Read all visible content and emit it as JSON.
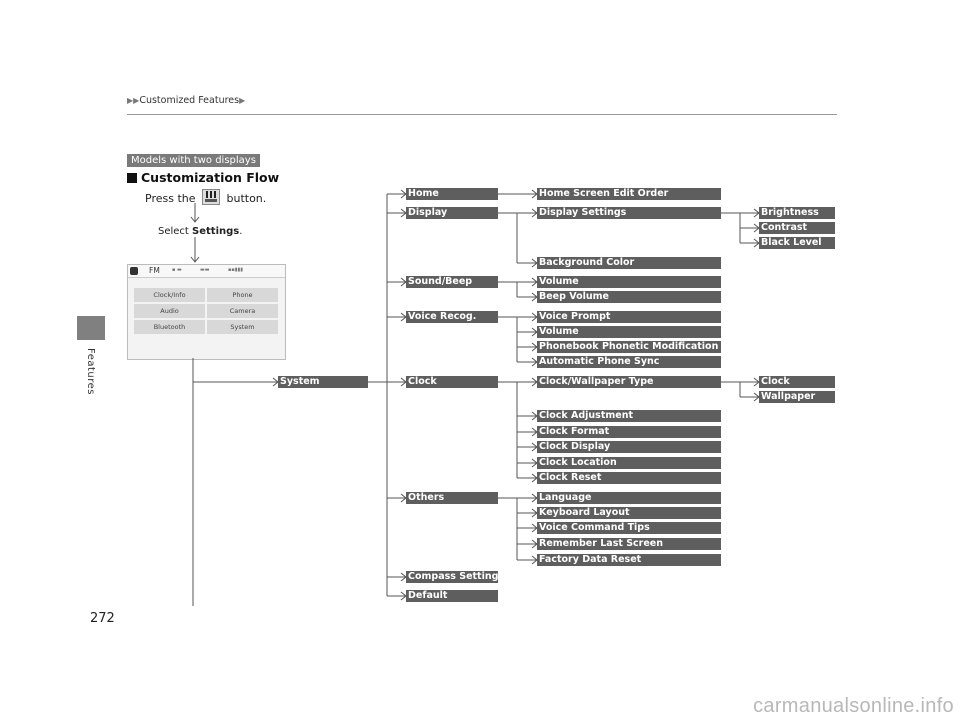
{
  "header": {
    "breadcrumb": "Customized Features",
    "page_number": "272",
    "side_tab_label": "Features"
  },
  "intro": {
    "badge": "Models with two displays",
    "title": "Customization Flow",
    "press_before": "Press the",
    "press_after": "button.",
    "home_icon": "home-button-icon",
    "select_prefix": "Select ",
    "select_bold": "Settings",
    "select_suffix": "."
  },
  "screen": {
    "status_band": "FM",
    "buttons": [
      "Clock/Info",
      "Phone",
      "Audio",
      "Camera",
      "Bluetooth",
      "System"
    ]
  },
  "tree": {
    "root": "System",
    "level1": [
      {
        "label": "Home",
        "children": [
          {
            "label": "Home Screen Edit Order"
          }
        ]
      },
      {
        "label": "Display",
        "children": [
          {
            "label": "Display Settings",
            "children": [
              "Brightness",
              "Contrast",
              "Black Level"
            ]
          },
          {
            "label": "Background Color"
          }
        ]
      },
      {
        "label": "Sound/Beep",
        "children": [
          {
            "label": "Volume"
          },
          {
            "label": "Beep Volume"
          }
        ]
      },
      {
        "label": "Voice Recog.",
        "children": [
          {
            "label": "Voice Prompt"
          },
          {
            "label": "Volume"
          },
          {
            "label": "Phonebook Phonetic Modification"
          },
          {
            "label": "Automatic Phone Sync"
          }
        ]
      },
      {
        "label": "Clock",
        "children": [
          {
            "label": "Clock/Wallpaper Type",
            "children": [
              "Clock",
              "Wallpaper"
            ]
          },
          {
            "label": "Clock Adjustment"
          },
          {
            "label": "Clock Format"
          },
          {
            "label": "Clock Display"
          },
          {
            "label": "Clock Location"
          },
          {
            "label": "Clock Reset"
          }
        ]
      },
      {
        "label": "Others",
        "children": [
          {
            "label": "Language"
          },
          {
            "label": "Keyboard Layout"
          },
          {
            "label": "Voice Command Tips"
          },
          {
            "label": "Remember Last Screen"
          },
          {
            "label": "Factory Data Reset"
          }
        ]
      },
      {
        "label": "Compass Setting"
      },
      {
        "label": "Default"
      }
    ]
  },
  "watermark": "carmanualsonline.info"
}
